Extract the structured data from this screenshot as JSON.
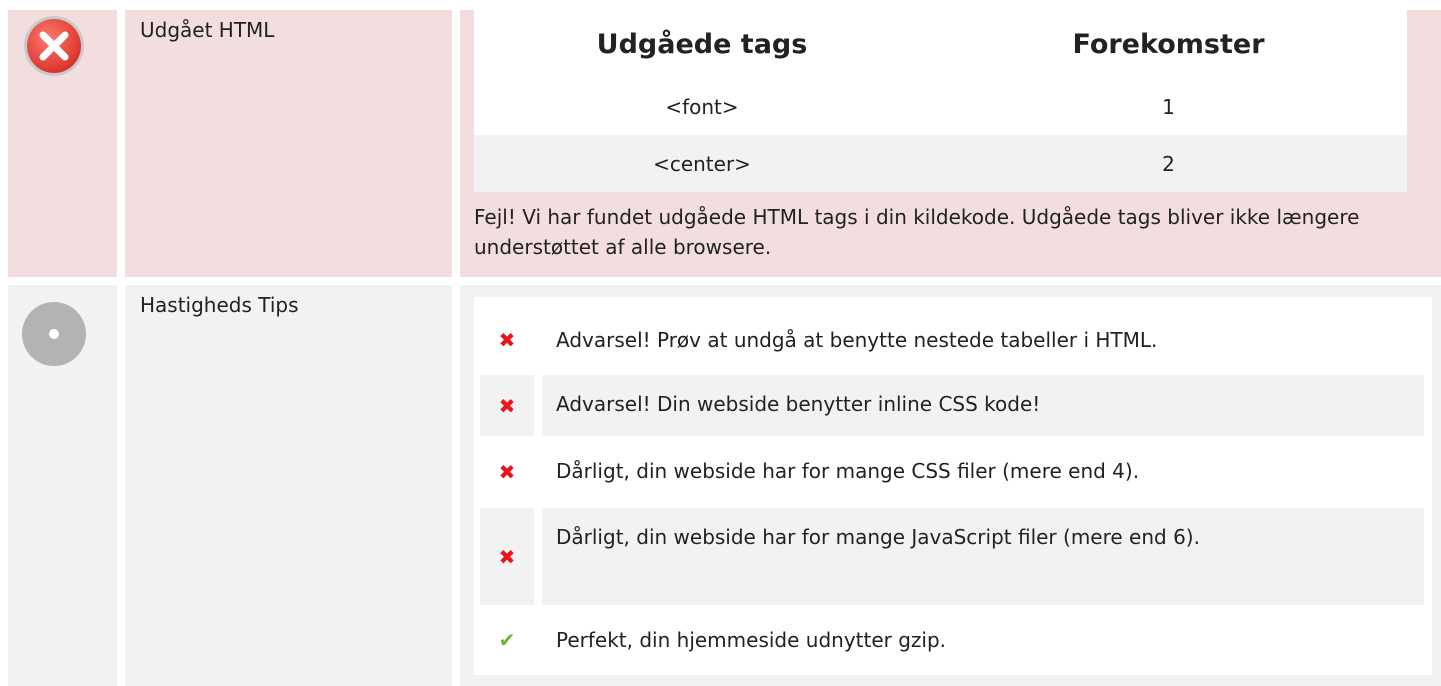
{
  "deprecated": {
    "label": "Udgået HTML",
    "status": "error",
    "table": {
      "headers": [
        "Udgåede tags",
        "Forekomster"
      ],
      "rows": [
        {
          "tag": "<font>",
          "count": "1"
        },
        {
          "tag": "<center>",
          "count": "2"
        }
      ]
    },
    "message": "Fejl! Vi har fundet udgåede HTML tags i din kildekode. Udgåede tags bliver ikke længere understøttet af alle browsere."
  },
  "speed": {
    "label": "Hastigheds Tips",
    "status": "neutral",
    "tips": [
      {
        "status": "bad",
        "icon": "cross-icon",
        "text": "Advarsel! Prøv at undgå at benytte nestede tabeller i HTML."
      },
      {
        "status": "bad",
        "icon": "cross-icon",
        "text": "Advarsel! Din webside benytter inline CSS kode!"
      },
      {
        "status": "bad",
        "icon": "cross-icon",
        "text": "Dårligt, din webside har for mange CSS filer (mere end 4)."
      },
      {
        "status": "bad",
        "icon": "cross-icon",
        "text": "Dårligt, din webside har for mange JavaScript filer (mere end 6)."
      },
      {
        "status": "good",
        "icon": "check-icon",
        "text": "Perfekt, din hjemmeside udnytter gzip."
      }
    ]
  },
  "colors": {
    "error_bg": "#f2dede",
    "neutral_bg": "#f2f2f2",
    "bad": "#e8141e",
    "good": "#6bb33a"
  }
}
